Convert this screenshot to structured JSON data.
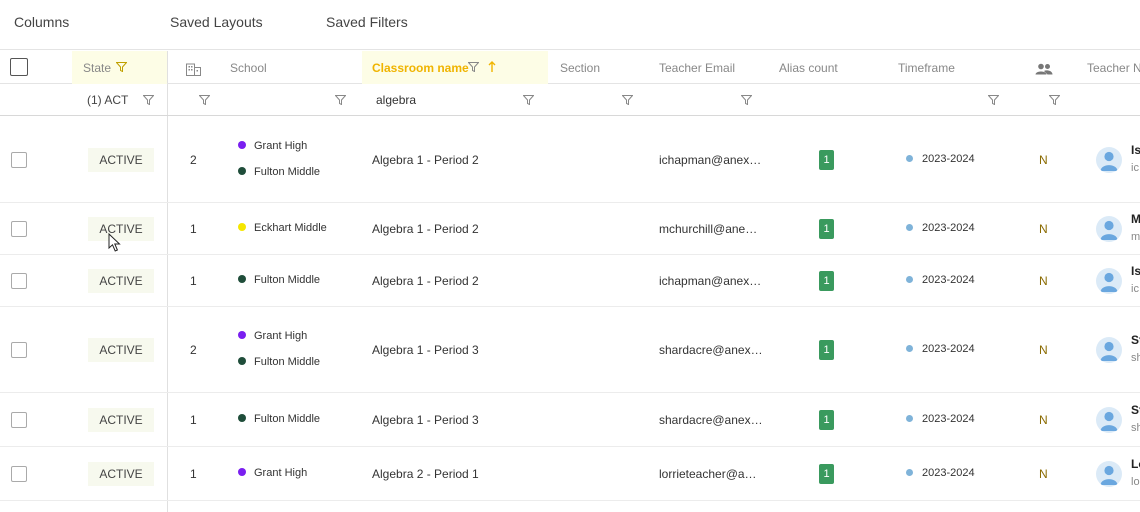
{
  "toolbar": {
    "columns_label": "Columns",
    "saved_layouts_label": "Saved Layouts",
    "saved_filters_label": "Saved Filters"
  },
  "headers": {
    "state": "State",
    "school": "School",
    "classroom_name": "Classroom name",
    "section": "Section",
    "teacher_email": "Teacher Email",
    "alias_count": "Alias count",
    "timeframe": "Timeframe",
    "teacher_name": "Teacher N"
  },
  "filters": {
    "state_value": "(1) ACT",
    "classroom_value": "algebra"
  },
  "colors": {
    "grant_high": "#7a1ff0",
    "fulton_middle": "#1f4d3a",
    "eckhart_middle": "#f5e600",
    "alias_badge": "#3a9a5e",
    "active_sort": "#f0b400"
  },
  "rows": [
    {
      "state": "ACTIVE",
      "school_count": "2",
      "schools": [
        {
          "name": "Grant High",
          "color": "#7a1ff0"
        },
        {
          "name": "Fulton Middle",
          "color": "#1f4d3a"
        }
      ],
      "classroom": "Algebra 1 - Period 2",
      "email": "ichapman@anex…",
      "alias": "1",
      "timeframe": "2023-2024",
      "n": "N",
      "teacher_name": "Is",
      "teacher_sub": "ic"
    },
    {
      "state": "ACTIVE",
      "school_count": "1",
      "schools": [
        {
          "name": "Eckhart Middle",
          "color": "#f5e600"
        }
      ],
      "classroom": "Algebra 1 - Period 2",
      "email": "mchurchill@ane…",
      "alias": "1",
      "timeframe": "2023-2024",
      "n": "N",
      "teacher_name": "M",
      "teacher_sub": "m"
    },
    {
      "state": "ACTIVE",
      "school_count": "1",
      "schools": [
        {
          "name": "Fulton Middle",
          "color": "#1f4d3a"
        }
      ],
      "classroom": "Algebra 1 - Period 2",
      "email": "ichapman@anex…",
      "alias": "1",
      "timeframe": "2023-2024",
      "n": "N",
      "teacher_name": "Is",
      "teacher_sub": "ic"
    },
    {
      "state": "ACTIVE",
      "school_count": "2",
      "schools": [
        {
          "name": "Grant High",
          "color": "#7a1ff0"
        },
        {
          "name": "Fulton Middle",
          "color": "#1f4d3a"
        }
      ],
      "classroom": "Algebra 1 - Period 3",
      "email": "shardacre@anex…",
      "alias": "1",
      "timeframe": "2023-2024",
      "n": "N",
      "teacher_name": "St",
      "teacher_sub": "sh"
    },
    {
      "state": "ACTIVE",
      "school_count": "1",
      "schools": [
        {
          "name": "Fulton Middle",
          "color": "#1f4d3a"
        }
      ],
      "classroom": "Algebra 1 - Period 3",
      "email": "shardacre@anex…",
      "alias": "1",
      "timeframe": "2023-2024",
      "n": "N",
      "teacher_name": "St",
      "teacher_sub": "sh"
    },
    {
      "state": "ACTIVE",
      "school_count": "1",
      "schools": [
        {
          "name": "Grant High",
          "color": "#7a1ff0"
        }
      ],
      "classroom": "Algebra 2 - Period 1",
      "email": "lorrieteacher@a…",
      "alias": "1",
      "timeframe": "2023-2024",
      "n": "N",
      "teacher_name": "Lo",
      "teacher_sub": "lo"
    }
  ]
}
